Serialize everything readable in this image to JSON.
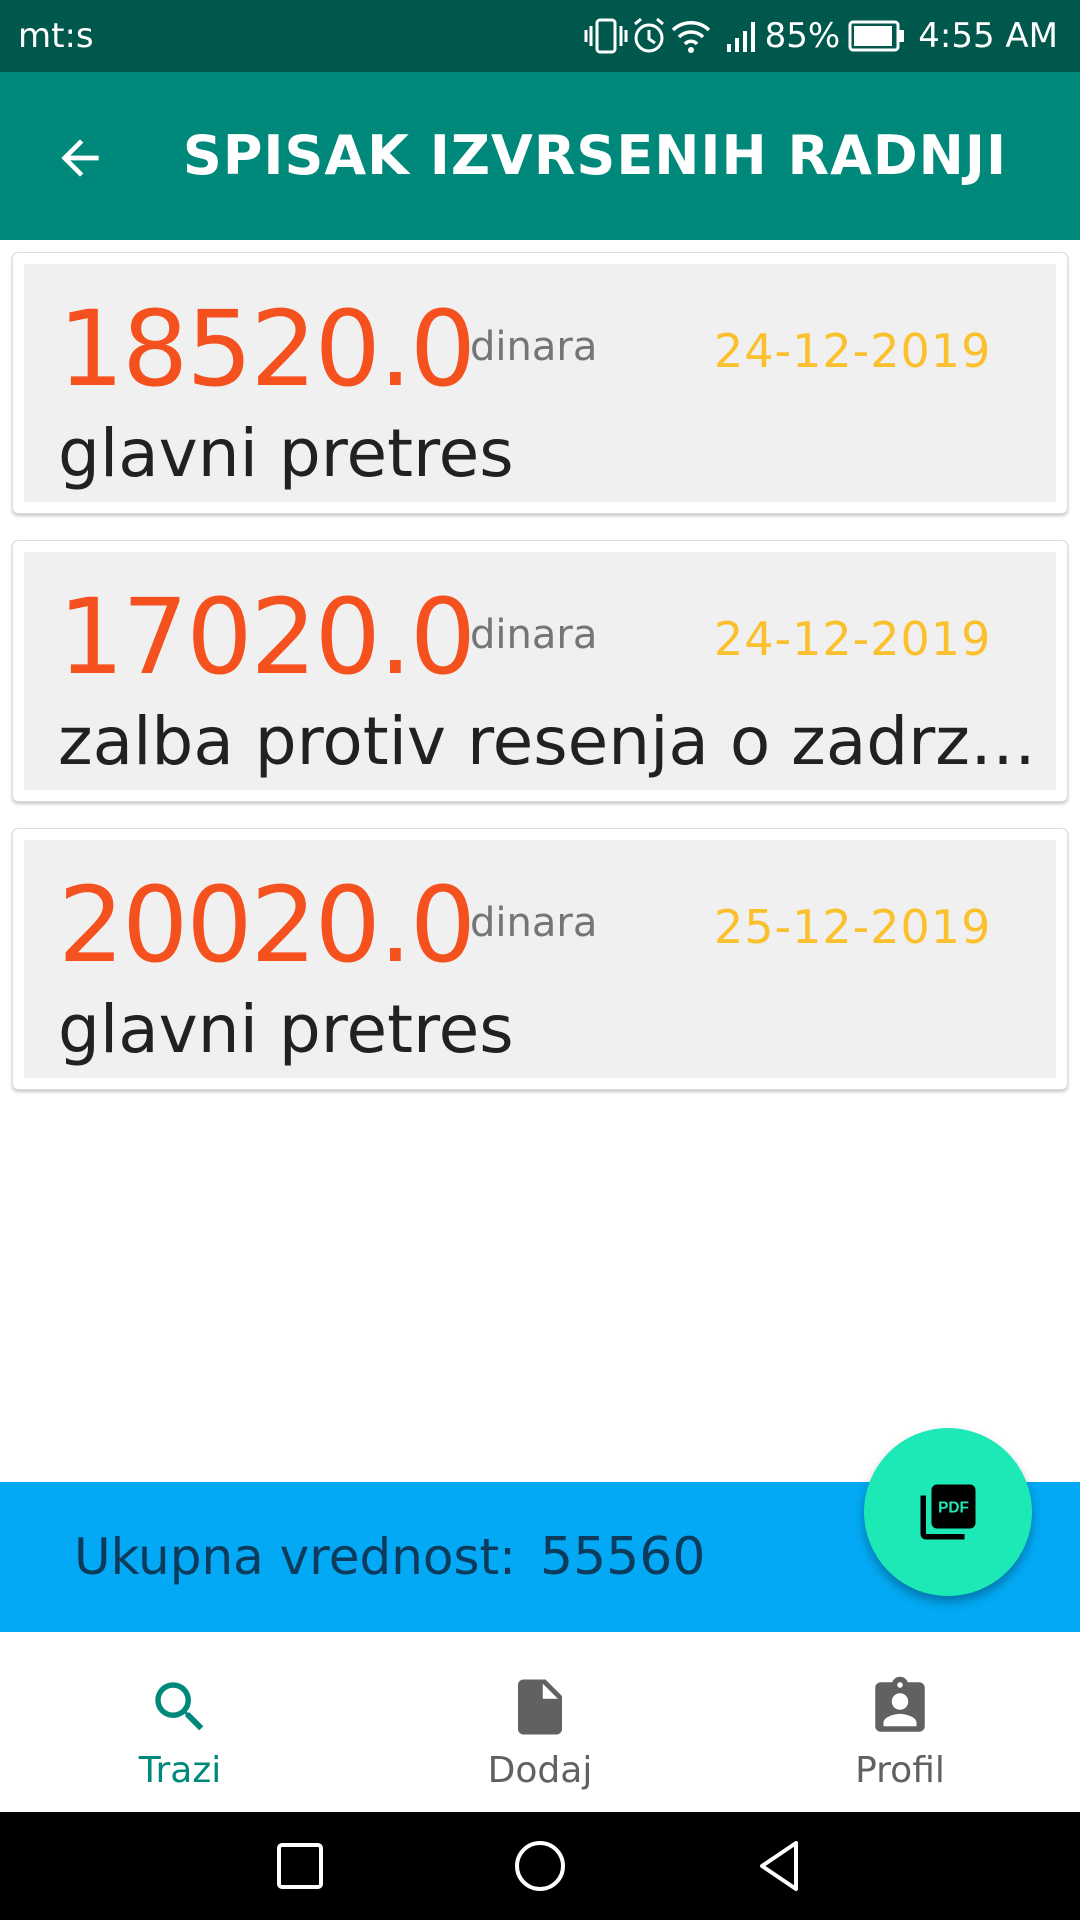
{
  "status_bar": {
    "carrier": "mt:s",
    "battery": "85%",
    "time": "4:55 AM",
    "icons": [
      "vibrate-icon",
      "alarm-icon",
      "wifi-icon",
      "signal-icon",
      "battery-icon"
    ]
  },
  "app_bar": {
    "title": "SPISAK IZVRSENIH RADNJI",
    "back_icon": "arrow-back-icon"
  },
  "items": [
    {
      "amount": "18520.0",
      "currency": "dinara",
      "date": "24-12-2019",
      "description": "glavni pretres"
    },
    {
      "amount": "17020.0",
      "currency": "dinara",
      "date": "24-12-2019",
      "description": "zalba protiv resenja o zadrzavanju"
    },
    {
      "amount": "20020.0",
      "currency": "dinara",
      "date": "25-12-2019",
      "description": "glavni pretres"
    }
  ],
  "total": {
    "label": "Ukupna vrednost:",
    "value": "55560"
  },
  "fab": {
    "icon": "pdf-icon"
  },
  "bottom_nav": {
    "items": [
      {
        "label": "Trazi",
        "icon": "search-icon",
        "active": true
      },
      {
        "label": "Dodaj",
        "icon": "document-icon",
        "active": false
      },
      {
        "label": "Profil",
        "icon": "profile-badge-icon",
        "active": false
      }
    ]
  },
  "colors": {
    "status_bar": "#00574b",
    "app_bar": "#00897b",
    "amount": "#f4511e",
    "date": "#fbc02d",
    "total_bar": "#03a9f4",
    "fab": "#1de9b6"
  }
}
